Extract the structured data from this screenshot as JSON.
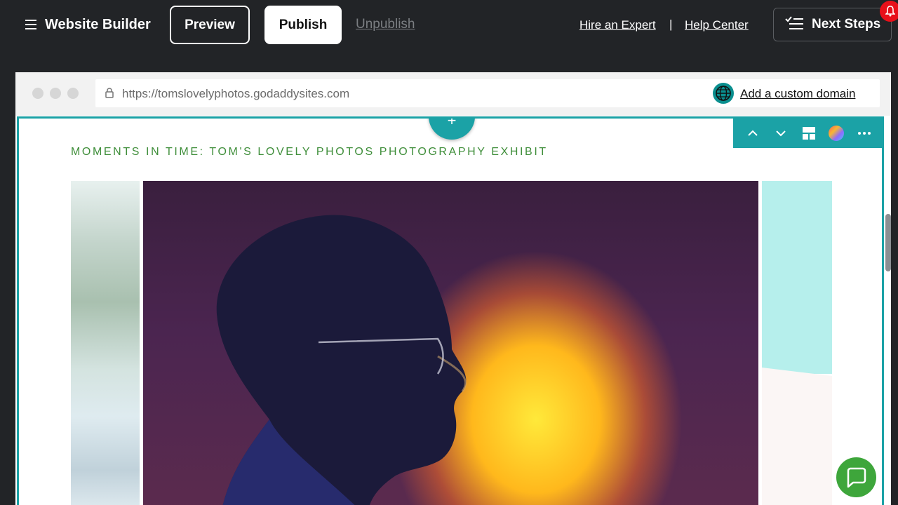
{
  "header": {
    "app_title": "Website Builder",
    "preview_label": "Preview",
    "publish_label": "Publish",
    "unpublish_label": "Unpublish",
    "hire_expert_label": "Hire an Expert",
    "separator": "|",
    "help_center_label": "Help Center",
    "next_steps_label": "Next Steps"
  },
  "browser": {
    "url": "https://tomslovelyphotos.godaddysites.com",
    "custom_domain_label": "Add a custom domain"
  },
  "canvas": {
    "section_title": "MOMENTS IN TIME: TOM'S LOVELY PHOTOS PHOTOGRAPHY EXHIBIT",
    "add_section_symbol": "+"
  },
  "icons": {
    "menu": "hamburger-menu-icon",
    "next_steps": "checklist-icon",
    "notification": "bell-icon",
    "lock": "lock-icon",
    "globe": "globe-icon",
    "toolbar": [
      "chevron-up-icon",
      "chevron-down-icon",
      "layout-icon",
      "color-palette-icon",
      "more-options-icon"
    ],
    "chat": "chat-icon"
  },
  "colors": {
    "topbar_bg": "#222427",
    "accent_teal": "#1ba2a6",
    "title_green": "#3f8e3a",
    "notification_red": "#e8101a",
    "chat_green": "#3ea63b"
  }
}
